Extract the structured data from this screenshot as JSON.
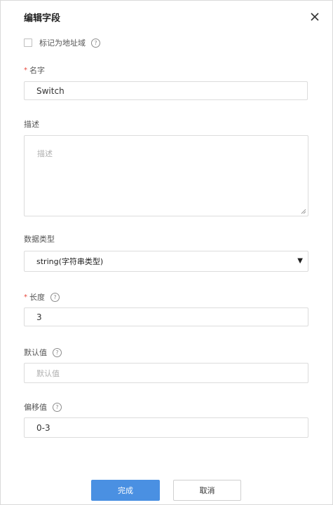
{
  "dialog": {
    "title": "编辑字段",
    "close_icon": "close-icon"
  },
  "address_checkbox": {
    "label": "标记为地址域",
    "checked": false,
    "help": "?"
  },
  "name_field": {
    "required_mark": "*",
    "label": "名字",
    "value": "Switch"
  },
  "description_field": {
    "label": "描述",
    "placeholder": "描述",
    "value": ""
  },
  "data_type_field": {
    "label": "数据类型",
    "selected": "string(字符串类型)",
    "arrow": "▼"
  },
  "length_field": {
    "required_mark": "*",
    "label": "长度",
    "help": "?",
    "value": "3"
  },
  "default_field": {
    "label": "默认值",
    "help": "?",
    "placeholder": "默认值",
    "value": ""
  },
  "offset_field": {
    "label": "偏移值",
    "help": "?",
    "value": "0-3"
  },
  "buttons": {
    "confirm": "完成",
    "cancel": "取消"
  },
  "colors": {
    "primary": "#4a90e2",
    "required": "#e8473b",
    "border": "#dcdcdc"
  }
}
